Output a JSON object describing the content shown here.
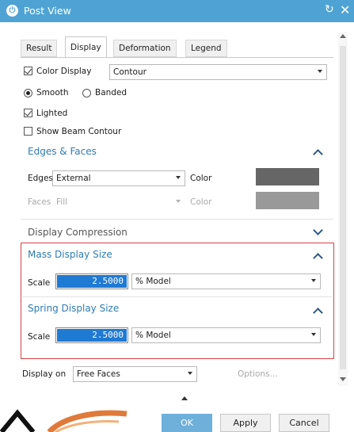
{
  "window": {
    "title": "Post View"
  },
  "tabs": [
    {
      "label": "Result"
    },
    {
      "label": "Display"
    },
    {
      "label": "Deformation"
    },
    {
      "label": "Legend"
    }
  ],
  "display": {
    "color_display": {
      "label": "Color Display",
      "checked": true,
      "value": "Contour"
    },
    "smooth_label": "Smooth",
    "banded_label": "Banded",
    "selected_mode": "Smooth",
    "lighted": {
      "label": "Lighted",
      "checked": true
    },
    "show_beam_contour": {
      "label": "Show Beam Contour",
      "checked": false
    }
  },
  "edges_faces": {
    "title": "Edges & Faces",
    "edges_label": "Edges",
    "edges_value": "External",
    "edges_color_label": "Color",
    "edges_color": "#666666",
    "faces_label": "Faces",
    "faces_value": "Fill",
    "faces_color_label": "Color",
    "faces_color": "#999999"
  },
  "display_compression": {
    "title": "Display Compression"
  },
  "mass_display_size": {
    "title": "Mass Display Size",
    "scale_label": "Scale",
    "scale_value": "2.5000",
    "unit": "% Model"
  },
  "spring_display_size": {
    "title": "Spring Display Size",
    "scale_label": "Scale",
    "scale_value": "2.5000",
    "unit": "% Model"
  },
  "display_on": {
    "label": "Display on",
    "value": "Free Faces",
    "options_label": "Options..."
  },
  "buttons": {
    "ok": "OK",
    "apply": "Apply",
    "cancel": "Cancel"
  },
  "colors": {
    "title_bar": "#4fa3d4",
    "section_title": "#2e7bb3",
    "highlight_border": "#d9404a",
    "selection": "#1f7ad4"
  }
}
